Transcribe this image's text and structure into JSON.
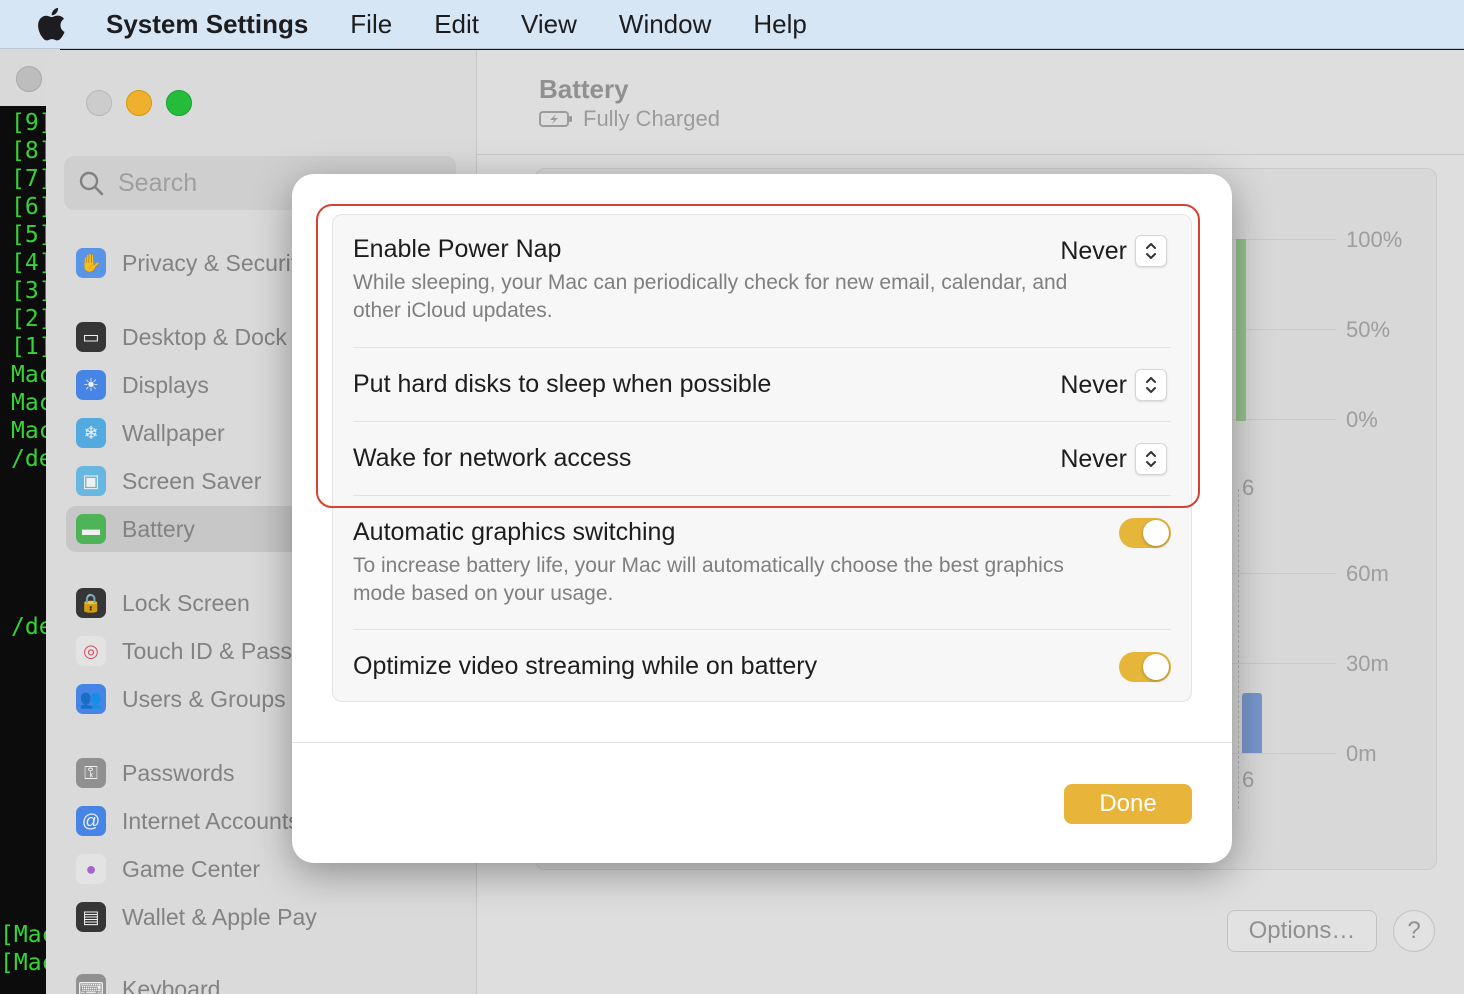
{
  "menubar": {
    "app_name": "System Settings",
    "items": [
      "File",
      "Edit",
      "View",
      "Window",
      "Help"
    ]
  },
  "terminal": {
    "lines": [
      "[9]",
      "[8]",
      "[7]",
      "[6]",
      "[5]",
      "[4]",
      "[3]",
      "[2]",
      "[1]",
      "Mac",
      "Mac",
      "Mac",
      "/de",
      "/de",
      "[Mac",
      "[Mac"
    ]
  },
  "sidebar": {
    "search_placeholder": "Search",
    "items": [
      {
        "label": "Privacy & Security",
        "icon": "hand-icon",
        "color": "#5e9ff5"
      },
      {
        "label": "Desktop & Dock",
        "icon": "dock-icon",
        "color": "#333333"
      },
      {
        "label": "Displays",
        "icon": "sun-icon",
        "color": "#4b8ef5"
      },
      {
        "label": "Wallpaper",
        "icon": "snowflake-icon",
        "color": "#58b5f0"
      },
      {
        "label": "Screen Saver",
        "icon": "screensaver-icon",
        "color": "#6fc3f0"
      },
      {
        "label": "Battery",
        "icon": "battery-icon",
        "color": "#54c05e"
      },
      {
        "label": "Lock Screen",
        "icon": "lock-icon",
        "color": "#333333"
      },
      {
        "label": "Touch ID & Password",
        "icon": "fingerprint-icon",
        "color": "#f2f2f2"
      },
      {
        "label": "Users & Groups",
        "icon": "users-icon",
        "color": "#4b8ef5"
      },
      {
        "label": "Passwords",
        "icon": "key-icon",
        "color": "#8e8e8e"
      },
      {
        "label": "Internet Accounts",
        "icon": "at-icon",
        "color": "#4b8ef5"
      },
      {
        "label": "Game Center",
        "icon": "game-center-icon",
        "color": "#f2f2f2"
      },
      {
        "label": "Wallet & Apple Pay",
        "icon": "wallet-icon",
        "color": "#333333"
      },
      {
        "label": "Keyboard",
        "icon": "keyboard-icon",
        "color": "#8e8e8e"
      }
    ],
    "selected": "Battery"
  },
  "main": {
    "title": "Battery",
    "subtitle": "Fully Charged",
    "chart_labels": {
      "level_ticks": [
        "100%",
        "50%",
        "0%"
      ],
      "level_x": "6",
      "usage_ticks": [
        "60m",
        "30m",
        "0m"
      ],
      "usage_x": "6"
    },
    "options_label": "Options…",
    "help_label": "?"
  },
  "sheet": {
    "rows": [
      {
        "label": "Enable Power Nap",
        "desc": "While sleeping, your Mac can periodically check for new email, calendar, and other iCloud updates.",
        "value": "Never"
      },
      {
        "label": "Put hard disks to sleep when possible",
        "value": "Never"
      },
      {
        "label": "Wake for network access",
        "value": "Never"
      },
      {
        "label": "Automatic graphics switching",
        "desc": "To increase battery life, your Mac will automatically choose the best graphics mode based on your usage.",
        "toggle": true
      },
      {
        "label": "Optimize video streaming while on battery",
        "toggle": true
      }
    ],
    "done_label": "Done",
    "accent": "#e9b43a",
    "highlight_color": "#d9412e"
  }
}
